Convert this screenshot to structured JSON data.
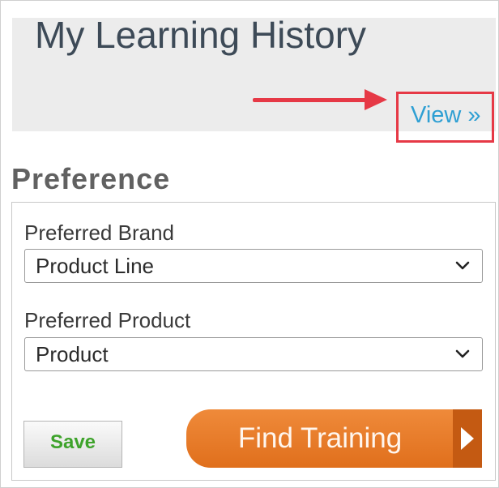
{
  "history": {
    "title": "My Learning History",
    "view_link": "View »"
  },
  "preference": {
    "heading": "Preference",
    "brand": {
      "label": "Preferred Brand",
      "selected": "Product Line"
    },
    "product": {
      "label": "Preferred Product",
      "selected": "Product"
    }
  },
  "actions": {
    "save_label": "Save",
    "find_label": "Find Training"
  },
  "colors": {
    "annotation_red": "#e63946",
    "link_blue": "#2e9fd3",
    "find_orange": "#e87a28",
    "save_green": "#3ea32b"
  },
  "icons": {
    "select_indicator": "chevron-down-icon",
    "find_indicator": "play-icon",
    "annotation_pointer": "arrow-right-icon"
  }
}
